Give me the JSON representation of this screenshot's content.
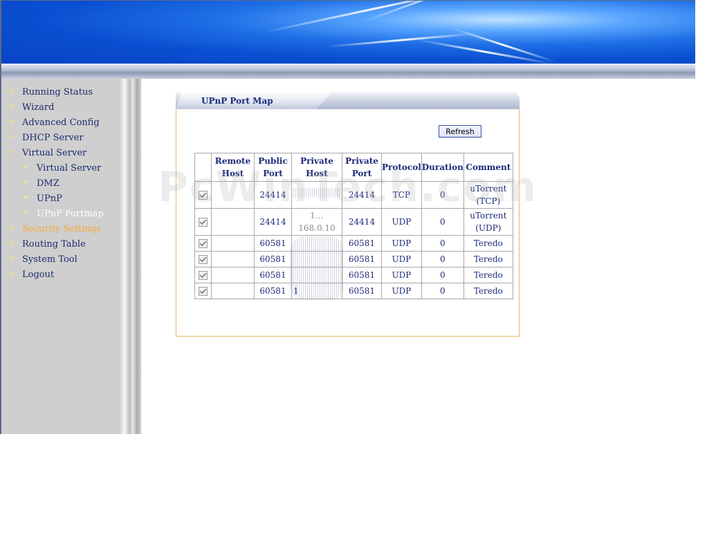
{
  "nav": {
    "items": [
      {
        "label": "Running Status"
      },
      {
        "label": "Wizard"
      },
      {
        "label": "Advanced Config"
      },
      {
        "label": "DHCP Server"
      },
      {
        "label": "Virtual Server"
      },
      {
        "label": "Virtual Server"
      },
      {
        "label": "DMZ"
      },
      {
        "label": "UPnP"
      },
      {
        "label": "UPnP Portmap"
      },
      {
        "label": "Security Settings"
      },
      {
        "label": "Routing Table"
      },
      {
        "label": "System Tool"
      },
      {
        "label": "Logout"
      }
    ]
  },
  "panel": {
    "title": "UPnP Port Map",
    "refresh_label": "Refresh"
  },
  "table": {
    "headers": [
      "Remote Host",
      "Public Port",
      "Private Host",
      "Private Port",
      "Protocol",
      "Duration",
      "Comment"
    ],
    "rows": [
      {
        "public_port": "24414",
        "private_host": "",
        "private_port": "24414",
        "protocol": "TCP",
        "duration": "0",
        "comment": "uTorrent (TCP)"
      },
      {
        "public_port": "24414",
        "private_host": "1…168.0.10",
        "private_port": "24414",
        "protocol": "UDP",
        "duration": "0",
        "comment": "uTorrent (UDP)"
      },
      {
        "public_port": "60581",
        "private_host": "",
        "private_port": "60581",
        "protocol": "UDP",
        "duration": "0",
        "comment": "Teredo"
      },
      {
        "public_port": "60581",
        "private_host": "",
        "private_port": "60581",
        "protocol": "UDP",
        "duration": "0",
        "comment": "Teredo"
      },
      {
        "public_port": "60581",
        "private_host": "",
        "private_port": "60581",
        "protocol": "UDP",
        "duration": "0",
        "comment": "Teredo"
      },
      {
        "public_port": "60581",
        "private_host": "1",
        "private_port": "60581",
        "protocol": "UDP",
        "duration": "0",
        "comment": "Teredo"
      }
    ]
  },
  "watermark": "PcWinTech.com",
  "colors": {
    "nav_text": "#1a2a6c",
    "nav_active": "#f7a832",
    "table_text": "#1b2a7a"
  }
}
